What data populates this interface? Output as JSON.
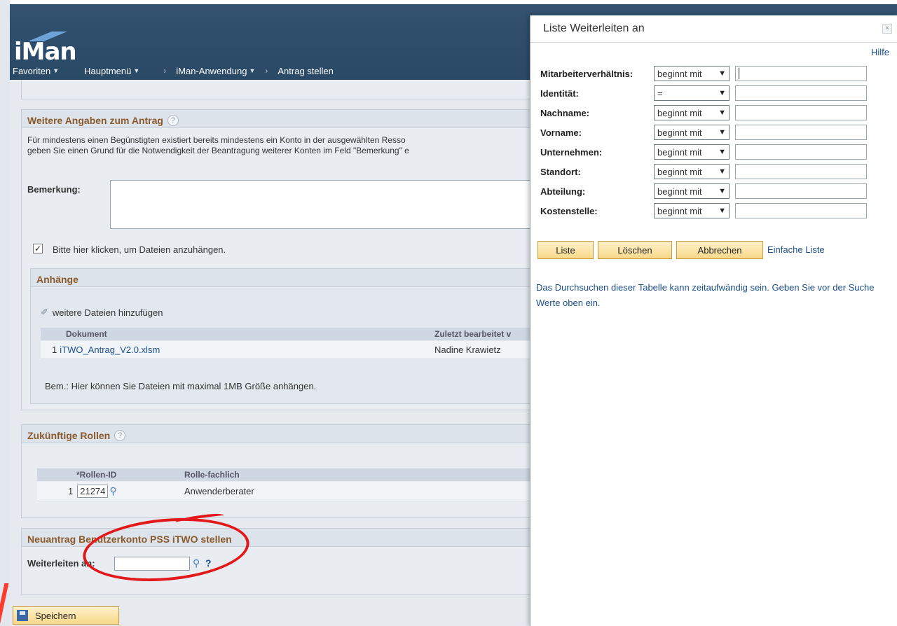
{
  "app": {
    "logo_text": "iMan"
  },
  "nav": [
    {
      "label": "Favoriten",
      "has_caret": true
    },
    {
      "label": "Hauptmenü",
      "has_caret": true
    },
    {
      "label": "iMan-Anwendung",
      "has_caret": true
    },
    {
      "label": "Antrag stellen",
      "has_caret": false
    }
  ],
  "weitere": {
    "title": "Weitere Angaben zum Antrag",
    "help": "?",
    "note_line1": "Für mindestens einen Begünstigten existiert bereits mindestens ein Konto in der ausgewählten Resso",
    "note_line2": "geben Sie einen Grund für die Notwendigkeit der Beantragung weiterer Konten im Feld \"Bemerkung\" e",
    "bemerkung_label": "Bemerkung:",
    "checkbox_label": "Bitte hier klicken, um Dateien anzuhängen.",
    "checkbox_checked": true
  },
  "anhaenge": {
    "title": "Anhänge",
    "add_link": "weitere Dateien hinzufügen",
    "columns": [
      "Dokument",
      "Zuletzt bearbeitet v"
    ],
    "rows": [
      {
        "num": "1",
        "doc": "iTWO_Antrag_V2.0.xlsm",
        "by": "Nadine Krawietz"
      }
    ],
    "note": "Bem.: Hier können Sie Dateien mit maximal 1MB Größe anhängen."
  },
  "rollen": {
    "title": "Zukünftige Rollen",
    "help": "?",
    "columns": [
      "*Rollen-ID",
      "Rolle-fachlich"
    ],
    "rows": [
      {
        "num": "1",
        "id": "21274",
        "role": "Anwenderberater"
      }
    ]
  },
  "neuantrag": {
    "title": "Neuantrag Benutzerkonto PSS iTWO stellen",
    "label": "Weiterleiten an:",
    "value": "",
    "help": "?"
  },
  "save_label": "Speichern",
  "modal": {
    "title": "Liste Weiterleiten an",
    "close": "×",
    "help": "Hilfe",
    "fields": [
      {
        "label": "Mitarbeiterverhältnis:",
        "op": "beginnt mit",
        "value": ""
      },
      {
        "label": "Identität:",
        "op": "=",
        "value": ""
      },
      {
        "label": "Nachname:",
        "op": "beginnt mit",
        "value": ""
      },
      {
        "label": "Vorname:",
        "op": "beginnt mit",
        "value": ""
      },
      {
        "label": "Unternehmen:",
        "op": "beginnt mit",
        "value": ""
      },
      {
        "label": "Standort:",
        "op": "beginnt mit",
        "value": ""
      },
      {
        "label": "Abteilung:",
        "op": "beginnt mit",
        "value": ""
      },
      {
        "label": "Kostenstelle:",
        "op": "beginnt mit",
        "value": ""
      }
    ],
    "buttons": {
      "liste": "Liste",
      "loeschen": "Löschen",
      "abbrechen": "Abbrechen"
    },
    "simple_link": "Einfache Liste",
    "note": "Das Durchsuchen dieser Tabelle kann zeitaufwändig sein. Geben Sie vor der Suche Werte oben ein."
  },
  "colors": {
    "header": "#2f4f6d",
    "section_title": "#8a5a2b",
    "link": "#1b4f8a",
    "annotation": "#e2181b",
    "button": "#f8d98a"
  }
}
